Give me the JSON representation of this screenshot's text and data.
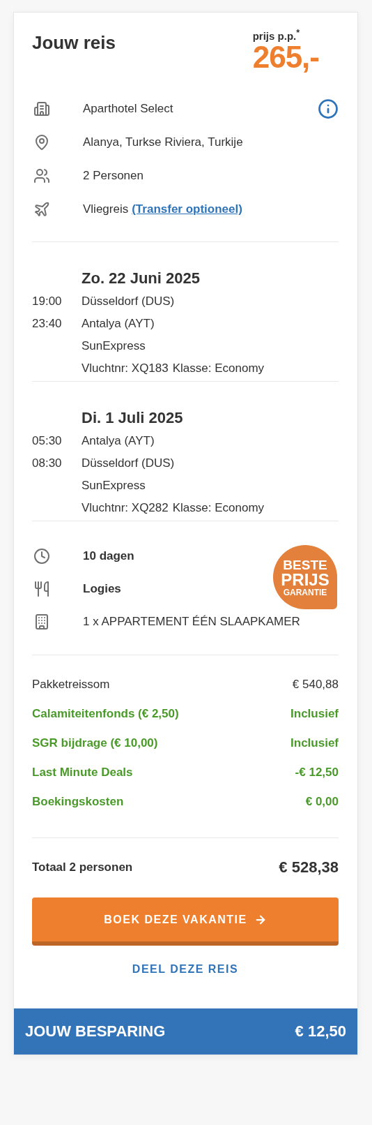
{
  "header": {
    "title": "Jouw reis",
    "price_label": "prijs p.p.$^{*}$",
    "price": "265,-"
  },
  "info": [
    {
      "kind": "hotel",
      "text": "Aparthotel Select"
    },
    {
      "kind": "location",
      "text": "Alanya, Turkse Riviera, Turkije"
    },
    {
      "kind": "persons",
      "text": "2 Personen"
    },
    {
      "kind": "flight",
      "text": "Vliegreis",
      "link": "(Transfer optioneel)"
    }
  ],
  "flights": [
    {
      "date": "Zo. 22 Juni 2025",
      "legs": [
        {
          "time": "19:00",
          "place": "Düsseldorf (DUS)"
        },
        {
          "time": "23:40",
          "place": "Antalya (AYT)"
        }
      ],
      "airline": "SunExpress",
      "flight_no": "Vluchtnr: XQ183",
      "class": "Klasse: Economy"
    },
    {
      "date": "Di. 1 Juli 2025",
      "legs": [
        {
          "time": "05:30",
          "place": "Antalya (AYT)"
        },
        {
          "time": "08:30",
          "place": "Düsseldorf (DUS)"
        }
      ],
      "airline": "SunExpress",
      "flight_no": "Vluchtnr: XQ282",
      "class": "Klasse: Economy"
    }
  ],
  "details": [
    {
      "kind": "duration",
      "text": "10 dagen",
      "emphasis": true
    },
    {
      "kind": "meals",
      "text": "Logies",
      "emphasis": true
    },
    {
      "kind": "room",
      "text": "1 x APPARTEMENT ÉÉN SLAAPKAMER",
      "emphasis": false
    }
  ],
  "badge": [
    "BESTE",
    "PRIJS",
    "GARANTIE"
  ],
  "prices": [
    {
      "label": "Pakketreissom",
      "value": "€ 540,88",
      "highlight": false
    },
    {
      "label": "Calamiteitenfonds (€ 2,50)",
      "value": "Inclusief",
      "highlight": true
    },
    {
      "label": "SGR bijdrage (€ 10,00)",
      "value": "Inclusief",
      "highlight": true
    },
    {
      "label": "Last Minute Deals",
      "value": "-€ 12,50",
      "highlight": true
    },
    {
      "label": "Boekingskosten",
      "value": "€ 0,00",
      "highlight": true
    }
  ],
  "total": {
    "label": "Totaal 2 personen",
    "value": "€ 528,38"
  },
  "buttons": {
    "book": "BOEK DEZE VAKANTIE",
    "share": "DEEL DEZE REIS"
  },
  "savings": {
    "label": "JOUW BESPARING",
    "value": "€ 12,50"
  }
}
